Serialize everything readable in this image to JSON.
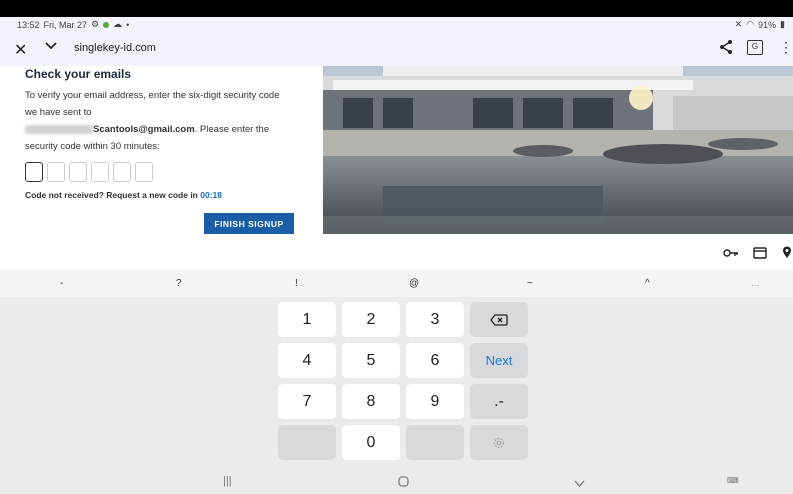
{
  "status_bar": {
    "time": "13:52",
    "date": "Fri, Mar 27",
    "battery": "91%"
  },
  "browser": {
    "url": "singlekey-id.com",
    "icons": [
      "close-icon",
      "chevron-down-icon",
      "share-icon",
      "translate-icon",
      "more-icon"
    ]
  },
  "page": {
    "heading": "Check your emails",
    "instruction_1": "To verify your email address, enter the six-digit security code we have sent to",
    "email_domain": "Scantools@gmail.com",
    "instruction_2": ". Please enter the security code within 30 minutes:",
    "resend_text": "Code not received? Request a new code in ",
    "countdown": "00:18",
    "finish_button": "FINISH SIGNUP"
  },
  "keyboard": {
    "symbols": [
      "-",
      "?",
      "!",
      "@",
      "~",
      "^",
      "..."
    ],
    "keys": {
      "k1": "1",
      "k2": "2",
      "k3": "3",
      "k4": "4",
      "k5": "5",
      "k6": "6",
      "k7": "7",
      "k8": "8",
      "k9": "9",
      "k0": "0",
      "next": "Next",
      "dot_dash": ".-"
    }
  },
  "colors": {
    "accent": "#1b5ea8",
    "timer": "#1a6fb5",
    "next_key": "#1a7bd6"
  }
}
